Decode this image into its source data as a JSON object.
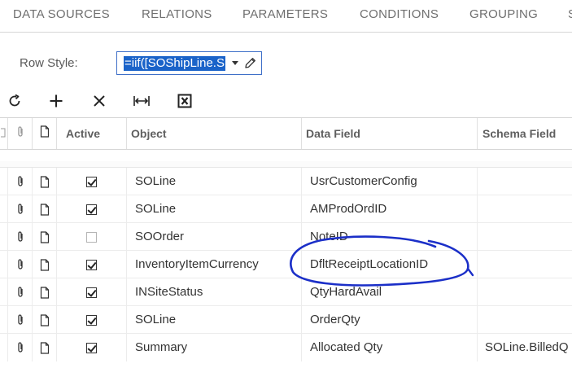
{
  "tabs": [
    {
      "label": "DATA SOURCES"
    },
    {
      "label": "RELATIONS"
    },
    {
      "label": "PARAMETERS"
    },
    {
      "label": "CONDITIONS"
    },
    {
      "label": "GROUPING"
    },
    {
      "label": "S"
    }
  ],
  "row_style": {
    "label": "Row Style:",
    "value": "=iif([SOShipLine.S"
  },
  "toolbar": {
    "icons": [
      "refresh-icon",
      "add-icon",
      "delete-icon",
      "fit-columns-icon",
      "export-excel-icon"
    ]
  },
  "grid": {
    "columns": {
      "active": "Active",
      "object": "Object",
      "data_field": "Data Field",
      "schema_field": "Schema Field"
    },
    "rows": [
      {
        "active": true,
        "object": "SOLine",
        "data_field": "UsrCustomerConfig",
        "schema_field": ""
      },
      {
        "active": true,
        "object": "SOLine",
        "data_field": "AMProdOrdID",
        "schema_field": ""
      },
      {
        "active": false,
        "object": "SOOrder",
        "data_field": "NoteID",
        "schema_field": ""
      },
      {
        "active": true,
        "object": "InventoryItemCurrency",
        "data_field": "DfltReceiptLocationID",
        "schema_field": ""
      },
      {
        "active": true,
        "object": "INSiteStatus",
        "data_field": "QtyHardAvail",
        "schema_field": ""
      },
      {
        "active": true,
        "object": "SOLine",
        "data_field": "OrderQty",
        "schema_field": ""
      },
      {
        "active": true,
        "object": "Summary",
        "data_field": "Allocated Qty",
        "schema_field": "SOLine.BilledQ"
      }
    ]
  },
  "colors": {
    "accent": "#1a63c9",
    "annotation": "#1b2fc8"
  }
}
